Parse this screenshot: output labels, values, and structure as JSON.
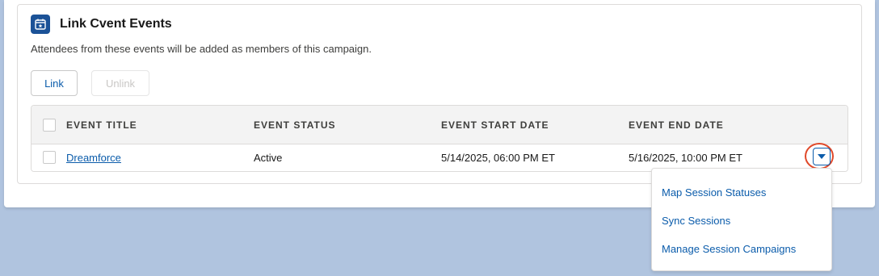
{
  "card": {
    "title": "Link Cvent Events",
    "description": "Attendees from these events will be added as members of this campaign.",
    "icon": "calendar-event-icon"
  },
  "buttons": {
    "link_label": "Link",
    "unlink_label": "Unlink"
  },
  "table": {
    "columns": [
      "EVENT TITLE",
      "EVENT STATUS",
      "EVENT START DATE",
      "EVENT END DATE"
    ],
    "rows": [
      {
        "title": "Dreamforce",
        "status": "Active",
        "start": "5/14/2025, 06:00 PM ET",
        "end": "5/16/2025, 10:00 PM ET"
      }
    ]
  },
  "row_menu": {
    "items": [
      "Map Session Statuses",
      "Sync Sessions",
      "Manage Session Campaigns"
    ]
  },
  "colors": {
    "accent": "#0b5cab",
    "highlight_ring": "#e0492a",
    "background": "#b0c4df"
  }
}
